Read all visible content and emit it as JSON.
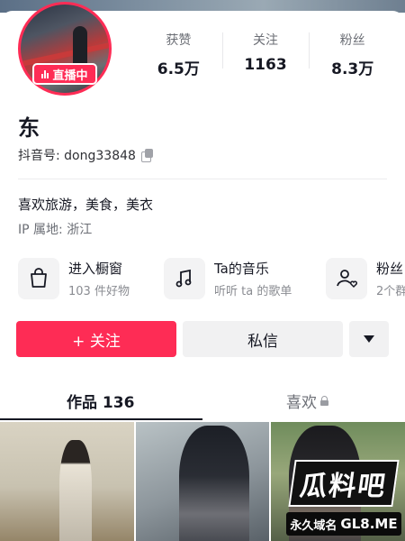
{
  "profile": {
    "live_label": "直播中",
    "name": "东",
    "douyin_id": "抖音号: dong33848",
    "bio": "喜欢旅游，美食，美衣",
    "ip_location": "IP 属地: 浙江"
  },
  "stats": [
    {
      "label": "获赞",
      "value": "6.5万"
    },
    {
      "label": "关注",
      "value": "1163"
    },
    {
      "label": "粉丝",
      "value": "8.3万"
    }
  ],
  "features": [
    {
      "title": "进入橱窗",
      "subtitle": "103 件好物",
      "icon": "shopping-bag-icon"
    },
    {
      "title": "Ta的音乐",
      "subtitle": "听听 ta 的歌单",
      "icon": "music-note-icon"
    },
    {
      "title": "粉丝",
      "subtitle": "2个群",
      "icon": "fans-heart-icon"
    }
  ],
  "actions": {
    "follow": "+ 关注",
    "message": "私信"
  },
  "tabs": {
    "works": "作品 136",
    "likes": "喜欢"
  },
  "watermark": {
    "title": "瓜料吧",
    "domain_prefix": "永久域名",
    "domain": "GL8.ME"
  },
  "colors": {
    "accent": "#fe2c55",
    "text": "#161823",
    "muted": "#6b6e75"
  }
}
